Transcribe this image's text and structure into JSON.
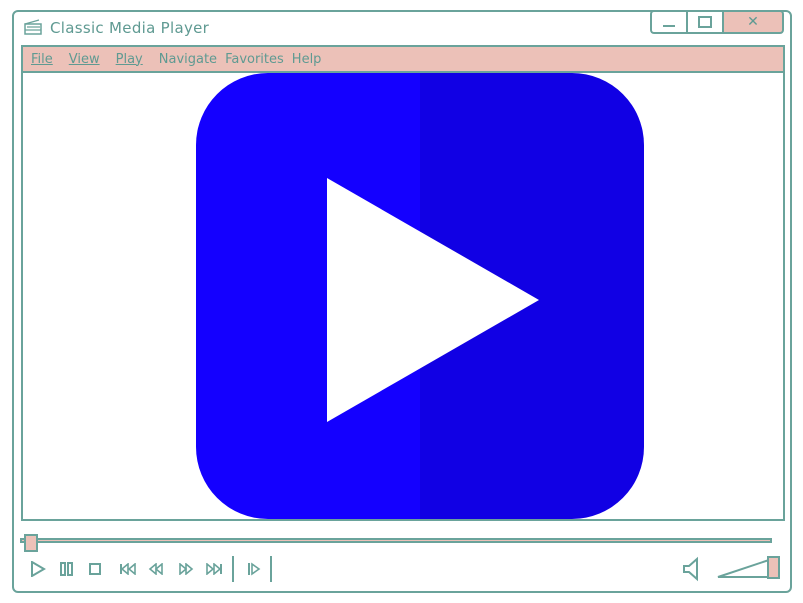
{
  "window": {
    "title": "Classic Media Player",
    "icon": "clapperboard-icon",
    "buttons": {
      "minimize": "minimize-icon",
      "maximize": "maximize-icon",
      "close": "✕"
    }
  },
  "menu": {
    "items": [
      "File",
      "View",
      "Play",
      "Navigate",
      "Favorites",
      "Help"
    ]
  },
  "video": {
    "overlay_icon": "play-icon"
  },
  "playback": {
    "progress": 0,
    "controls": [
      "play-icon",
      "pause-icon",
      "stop-icon",
      "skip-back-icon",
      "rewind-icon",
      "fast-forward-icon",
      "skip-forward-icon",
      "frame-step-icon"
    ],
    "volume": 1.0
  },
  "colors": {
    "accent": "#6aa39b",
    "highlight": "#ecc1b8",
    "play_blue_left": "#1400ff",
    "play_blue_right": "#1100e4"
  }
}
